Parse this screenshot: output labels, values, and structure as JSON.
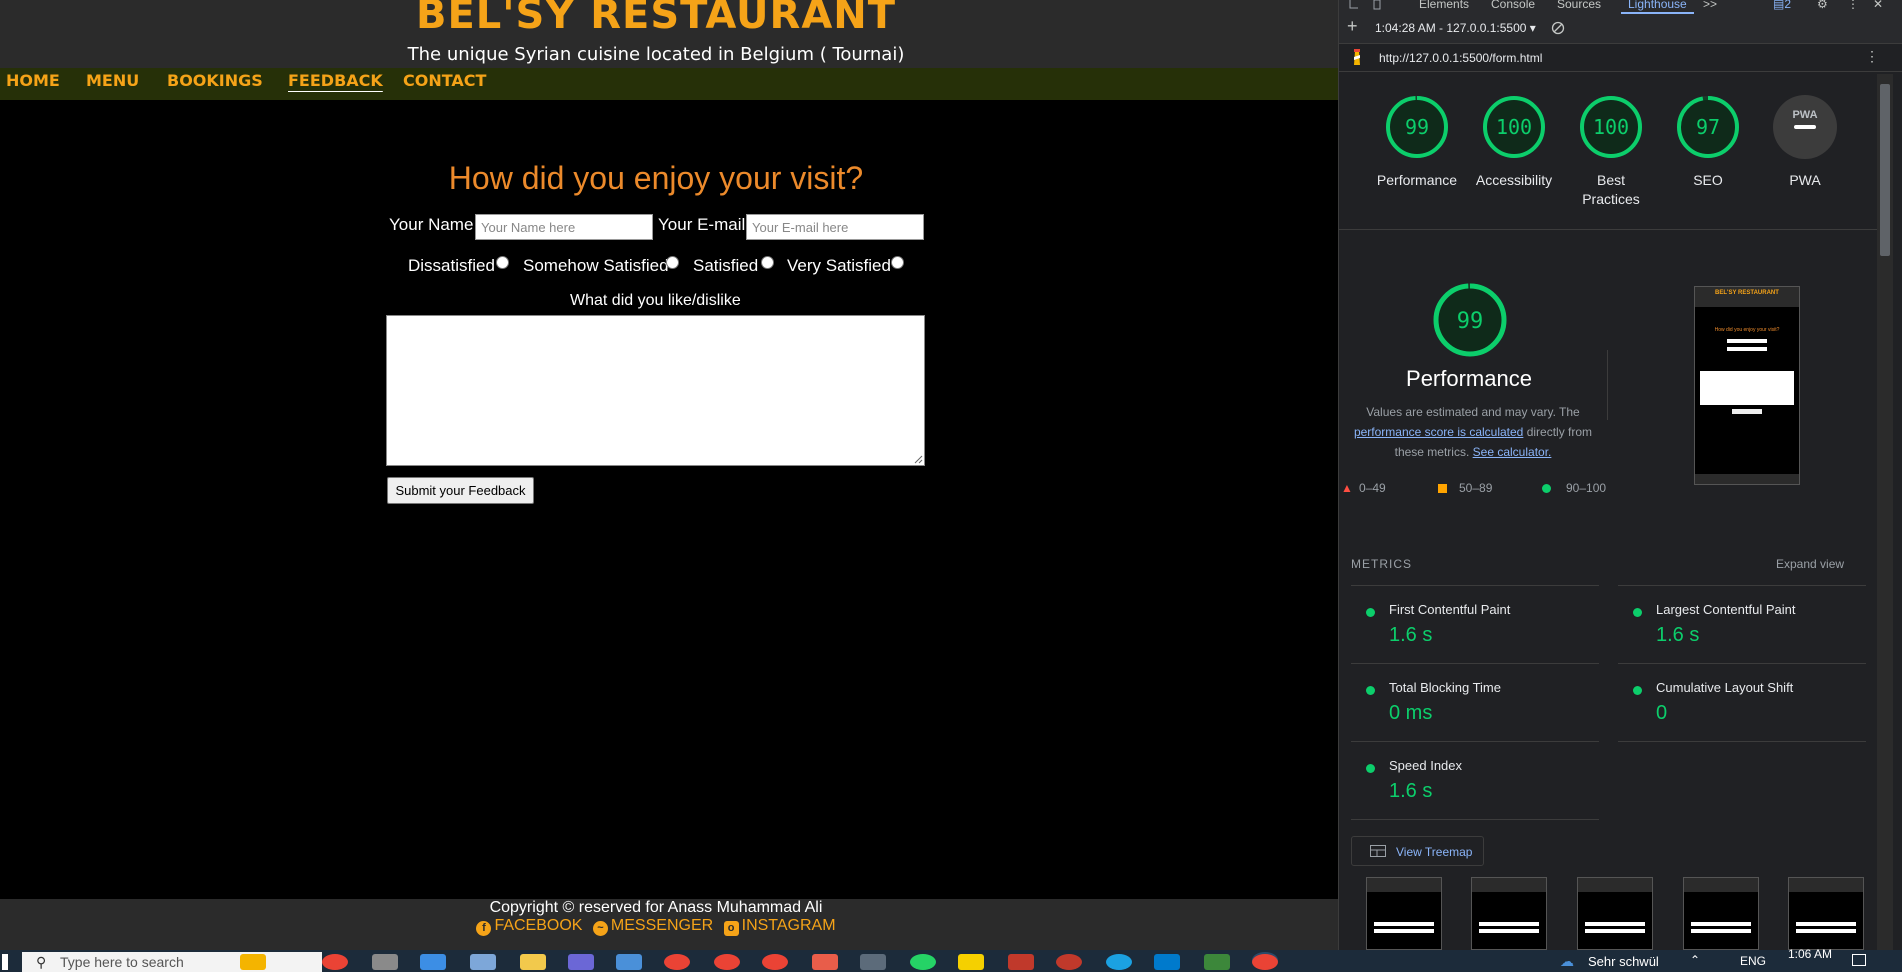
{
  "site": {
    "title": "BEL'SY RESTAURANT",
    "tagline": "The unique Syrian cuisine located in Belgium ( Tournai)",
    "nav": [
      "HOME",
      "MENU",
      "BOOKINGS",
      "FEEDBACK",
      "CONTACT"
    ],
    "active_nav": "FEEDBACK",
    "form": {
      "heading": "How did you enjoy your visit?",
      "name_label": "Your Name",
      "name_placeholder": "Your Name here",
      "email_label": "Your E-mail",
      "email_placeholder": "Your E-mail here",
      "ratings": [
        "Dissatisfied",
        "Somehow Satisfied",
        "Satisfied",
        "Very Satisfied"
      ],
      "comment_label": "What did you like/dislike",
      "submit_label": "Submit your Feedback"
    },
    "footer": {
      "copyright": "Copyright © reserved for Anass Muhammad Ali",
      "social": [
        "FACEBOOK",
        "MESSENGER",
        "INSTAGRAM"
      ]
    }
  },
  "devtools": {
    "tabs": [
      "Elements",
      "Console",
      "Sources",
      "Lighthouse"
    ],
    "active_tab": "Lighthouse",
    "more_tabs": ">>",
    "issues_count": "2",
    "report_select": "1:04:28 AM - 127.0.0.1:5500",
    "report_url": "http://127.0.0.1:5500/form.html",
    "scores": [
      {
        "label": "Performance",
        "value": 99
      },
      {
        "label": "Accessibility",
        "value": 100
      },
      {
        "label": "Best Practices",
        "value": 100
      },
      {
        "label": "SEO",
        "value": 97
      },
      {
        "label": "PWA",
        "value": "PWA"
      }
    ],
    "perf_title": "Performance",
    "perf_score": 99,
    "perf_note_pre": "Values are estimated and may vary. The",
    "perf_note_link": "performance score is calculated",
    "perf_note_mid": "directly from these metrics.",
    "perf_note_link2": "See calculator.",
    "legend": [
      "0–49",
      "50–89",
      "90–100"
    ],
    "metrics_heading": "METRICS",
    "expand_view": "Expand view",
    "metrics": [
      {
        "name": "First Contentful Paint",
        "value": "1.6 s"
      },
      {
        "name": "Largest Contentful Paint",
        "value": "1.6 s"
      },
      {
        "name": "Total Blocking Time",
        "value": "0 ms"
      },
      {
        "name": "Cumulative Layout Shift",
        "value": "0"
      },
      {
        "name": "Speed Index",
        "value": "1.6 s"
      }
    ],
    "treemap_label": "View Treemap",
    "thumb_title": "BEL'SY RESTAURANT",
    "thumb_heading": "How did you enjoy your visit?"
  },
  "taskbar": {
    "search_placeholder": "Type here to search",
    "weather": "Sehr schwül",
    "language": "ENG",
    "time": "1:06 AM"
  },
  "colors": {
    "brand_orange": "#f5a318",
    "heading_orange": "#ec8a2b",
    "nav_bg": "#263008",
    "score_green": "#0cce6b",
    "devtools_bg": "#202124"
  }
}
